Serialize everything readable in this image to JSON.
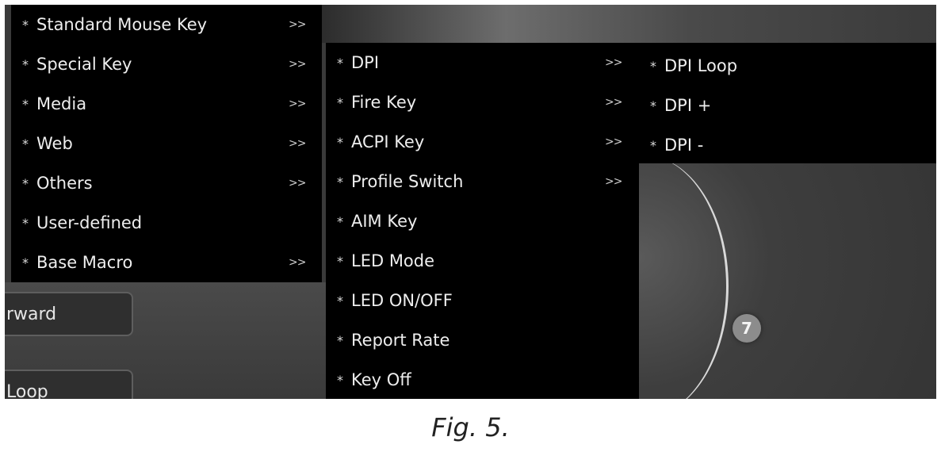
{
  "menu_level1": [
    {
      "label": "Standard Mouse Key",
      "arrow": ">>"
    },
    {
      "label": "Special Key",
      "arrow": ">>"
    },
    {
      "label": "Media",
      "arrow": ">>"
    },
    {
      "label": "Web",
      "arrow": ">>"
    },
    {
      "label": "Others",
      "arrow": ">>"
    },
    {
      "label": "User-defined",
      "arrow": ""
    },
    {
      "label": "Base Macro",
      "arrow": ">>"
    }
  ],
  "menu_level2": [
    {
      "label": "DPI",
      "arrow": ">>"
    },
    {
      "label": "Fire Key",
      "arrow": ">>"
    },
    {
      "label": "ACPI Key",
      "arrow": ">>"
    },
    {
      "label": "Profile Switch",
      "arrow": ">>"
    },
    {
      "label": "AIM Key",
      "arrow": ""
    },
    {
      "label": "LED Mode",
      "arrow": ""
    },
    {
      "label": "LED ON/OFF",
      "arrow": ""
    },
    {
      "label": "Report Rate",
      "arrow": ""
    },
    {
      "label": "Key Off",
      "arrow": ""
    }
  ],
  "menu_level3": [
    {
      "label": "DPI Loop"
    },
    {
      "label": "DPI +"
    },
    {
      "label": "DPI -"
    }
  ],
  "bullet": "*",
  "background_fields": [
    "rward",
    "Loop"
  ],
  "button_badge": "7",
  "caption": "Fig. 5."
}
